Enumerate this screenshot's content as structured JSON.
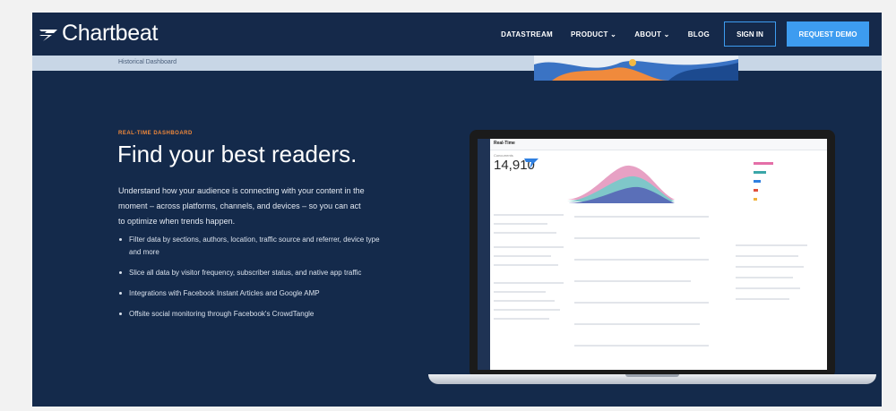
{
  "nav": {
    "logo_text": "Chartbeat",
    "links": [
      "DATASTREAM",
      "PRODUCT",
      "ABOUT",
      "BLOG"
    ],
    "sign_in": "SIGN IN",
    "request_demo": "REQUEST DEMO"
  },
  "subbar": {
    "label": "Historical Dashboard"
  },
  "hero": {
    "eyebrow": "REAL-TIME DASHBOARD",
    "headline": "Find your best readers.",
    "description": "Understand how your audience is connecting with your content in the moment – across platforms, channels, and devices – so you can act to optimize when trends happen.",
    "bullets": [
      "Filter data by sections, authors, location, traffic source and referrer, device type and more",
      "Slice all data by visitor frequency, subscriber status, and native app traffic",
      "Integrations with Facebook Instant Articles and Google AMP",
      "Offsite social monitoring through Facebook's CrowdTangle"
    ]
  },
  "screen": {
    "title": "Real-Time",
    "concurrents": "14,910",
    "concurrents_label": "Concurrents"
  },
  "colors": {
    "accent": "#3d9cf0",
    "eyebrow": "#f0883a",
    "background": "#142a4b"
  }
}
